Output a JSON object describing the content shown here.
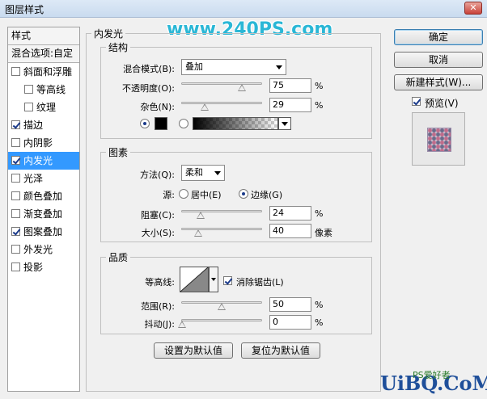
{
  "window": {
    "title": "图层样式"
  },
  "watermark": "www.240PS.com",
  "sidebar": {
    "header": "样式",
    "blend_options": "混合选项:自定",
    "items": [
      {
        "label": "斜面和浮雕",
        "checked": false,
        "sub": false
      },
      {
        "label": "等高线",
        "checked": false,
        "sub": true
      },
      {
        "label": "纹理",
        "checked": false,
        "sub": true
      },
      {
        "label": "描边",
        "checked": true,
        "sub": false
      },
      {
        "label": "内阴影",
        "checked": false,
        "sub": false
      },
      {
        "label": "内发光",
        "checked": true,
        "sub": false,
        "active": true
      },
      {
        "label": "光泽",
        "checked": false,
        "sub": false
      },
      {
        "label": "颜色叠加",
        "checked": false,
        "sub": false
      },
      {
        "label": "渐变叠加",
        "checked": false,
        "sub": false
      },
      {
        "label": "图案叠加",
        "checked": true,
        "sub": false
      },
      {
        "label": "外发光",
        "checked": false,
        "sub": false
      },
      {
        "label": "投影",
        "checked": false,
        "sub": false
      }
    ]
  },
  "panel": {
    "title": "内发光",
    "structure": {
      "title": "结构",
      "blend_mode_label": "混合模式(B):",
      "blend_mode_value": "叠加",
      "opacity_label": "不透明度(O):",
      "opacity_value": "75",
      "noise_label": "杂色(N):",
      "noise_value": "29",
      "percent": "%"
    },
    "elements": {
      "title": "图素",
      "method_label": "方法(Q):",
      "method_value": "柔和",
      "source_label": "源:",
      "source_center": "居中(E)",
      "source_edge": "边缘(G)",
      "choke_label": "阻塞(C):",
      "choke_value": "24",
      "size_label": "大小(S):",
      "size_value": "40",
      "size_unit": "像素",
      "percent": "%"
    },
    "quality": {
      "title": "品质",
      "contour_label": "等高线:",
      "antialias_label": "消除锯齿(L)",
      "range_label": "范围(R):",
      "range_value": "50",
      "jitter_label": "抖动(J):",
      "jitter_value": "0",
      "percent": "%"
    },
    "set_default": "设置为默认值",
    "reset_default": "复位为默认值"
  },
  "right": {
    "ok": "确定",
    "cancel": "取消",
    "new_style": "新建样式(W)...",
    "preview_label": "预览(V)"
  },
  "footer": {
    "logo": "UiBQ.CoM",
    "sub_text": "PS爱好者"
  }
}
